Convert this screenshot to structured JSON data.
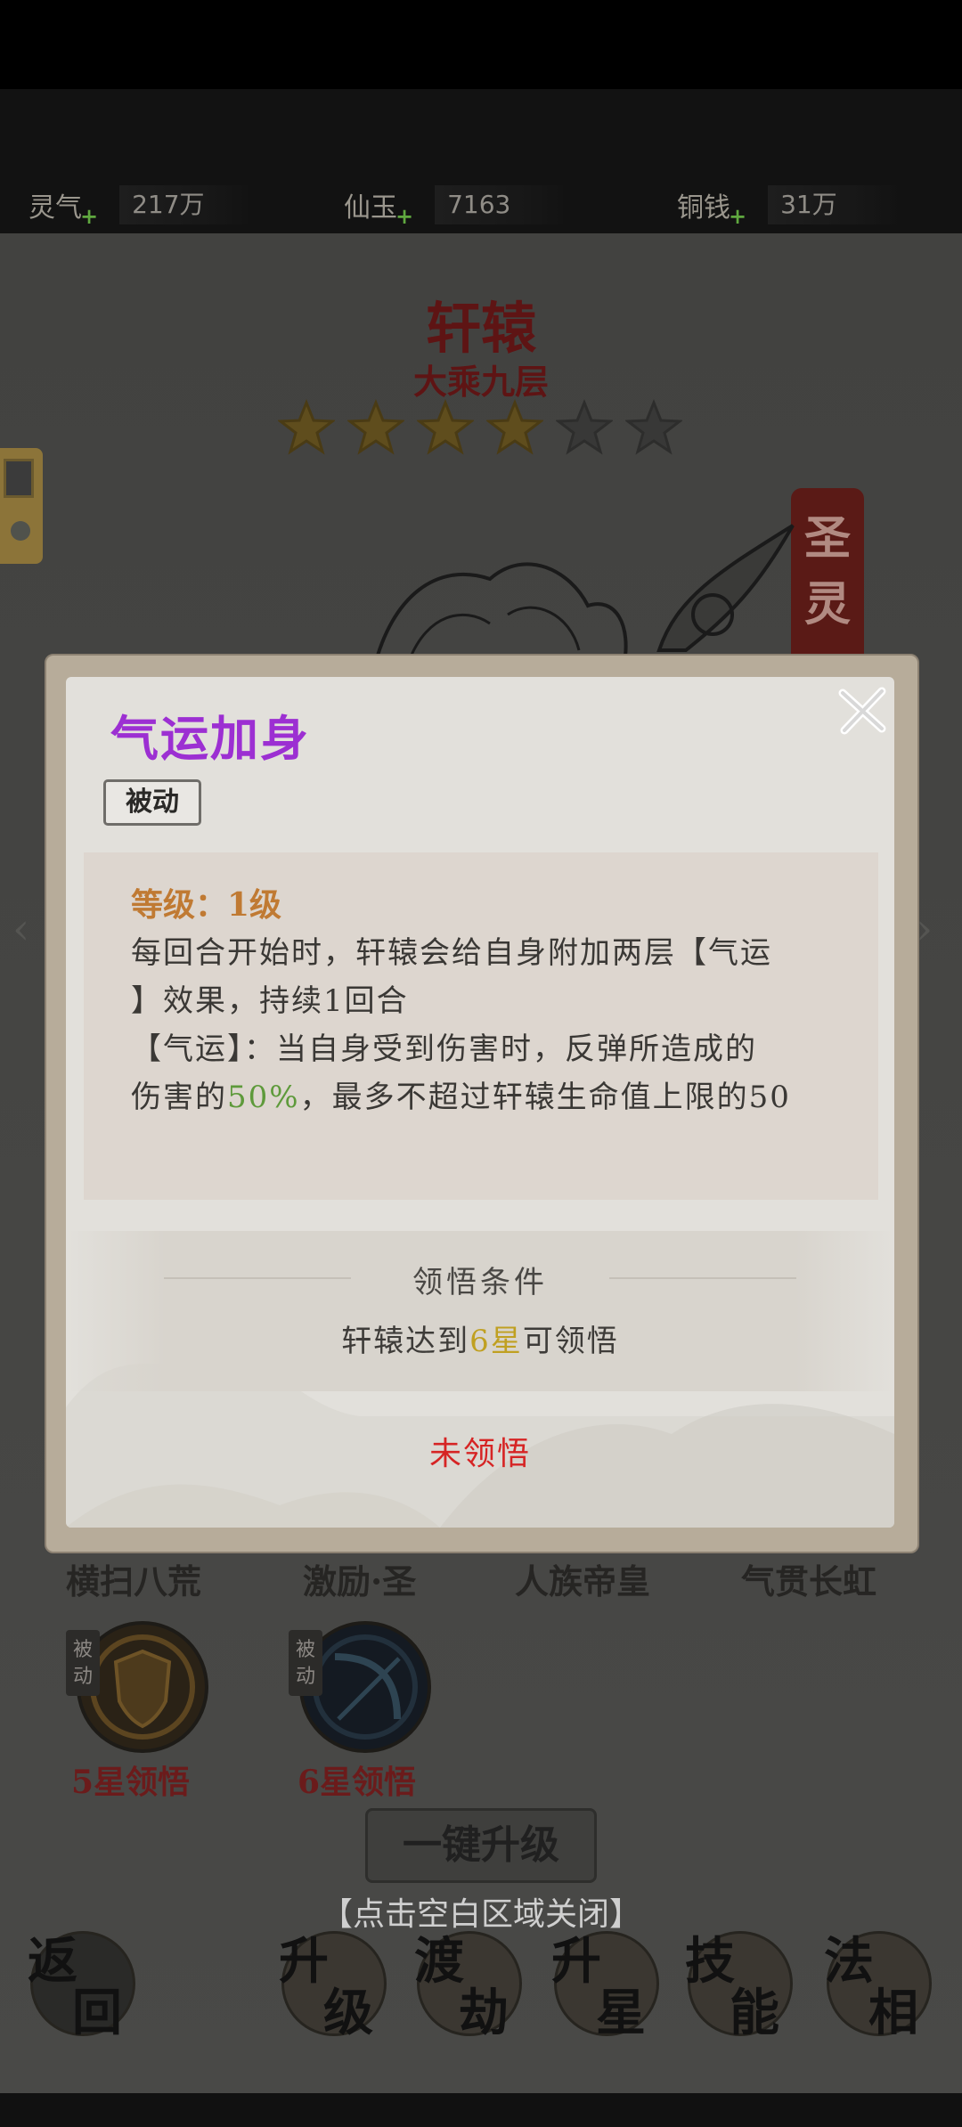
{
  "currencies": [
    {
      "label": "灵气",
      "value": "217万"
    },
    {
      "label": "仙玉",
      "value": "7163"
    },
    {
      "label": "铜钱",
      "value": "31万"
    }
  ],
  "hero": {
    "name": "轩辕",
    "rank": "大乘九层",
    "stars_filled": 4,
    "stars_total": 6
  },
  "banner": {
    "text": "圣灵"
  },
  "dialog": {
    "title": "气运加身",
    "tag": "被动",
    "level": "等级：1级",
    "description_line1": "每回合开始时，轩辕会给自身附加两层【气运",
    "description_line2": "】效果，持续1回合",
    "description_line3": "【气运】：当自身受到伤害时，反弹所造成的",
    "description_line4_prefix": "伤害的",
    "description_line4_highlight": "50%",
    "description_line4_suffix": "，最多不超过轩辕生命值上限的50",
    "condition_title": "领悟条件",
    "condition_prefix": "轩辕达到",
    "condition_highlight": "6星",
    "condition_suffix": "可领悟",
    "status": "未领悟"
  },
  "skills": [
    {
      "name": "横扫八荒"
    },
    {
      "name": "激励·圣"
    },
    {
      "name": "人族帝皇"
    },
    {
      "name": "气贯长虹"
    }
  ],
  "locked_skills": [
    {
      "tag": "被动",
      "unlock": "5星领悟"
    },
    {
      "tag": "被动",
      "unlock": "6星领悟"
    }
  ],
  "upgrade_all": "一键升级",
  "close_hint": "【点击空白区域关闭】",
  "nav": [
    {
      "c1": "返",
      "c2": "回"
    },
    {
      "c1": "升",
      "c2": "级"
    },
    {
      "c1": "渡",
      "c2": "劫"
    },
    {
      "c1": "升",
      "c2": "星"
    },
    {
      "c1": "技",
      "c2": "能"
    },
    {
      "c1": "法",
      "c2": "相"
    }
  ],
  "colors": {
    "title_purple": "#9c2fd2",
    "level_orange": "#c07a33",
    "highlight_green": "#5e9a3b",
    "highlight_gold": "#c0a021",
    "status_red": "#d62424"
  }
}
